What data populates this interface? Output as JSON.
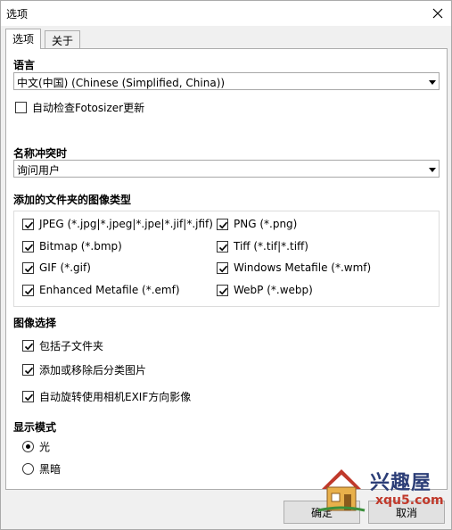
{
  "window": {
    "title": "选项"
  },
  "tabs": [
    {
      "label": "选项",
      "active": true
    },
    {
      "label": "关于",
      "active": false
    }
  ],
  "language": {
    "label": "语言",
    "selected": "中文(中国) (Chinese (Simplified, China))",
    "auto_check_label": "自动检查Fotosizer更新",
    "auto_check": false
  },
  "name_conflict": {
    "label": "名称冲突时",
    "selected": "询问用户"
  },
  "image_types": {
    "label": "添加的文件夹的图像类型",
    "items": [
      {
        "label": "JPEG (*.jpg|*.jpeg|*.jpe|*.jif|*.jfif)",
        "checked": true
      },
      {
        "label": "PNG (*.png)",
        "checked": true
      },
      {
        "label": "Bitmap (*.bmp)",
        "checked": true
      },
      {
        "label": "Tiff (*.tif|*.tiff)",
        "checked": true
      },
      {
        "label": "GIF (*.gif)",
        "checked": true
      },
      {
        "label": "Windows Metafile (*.wmf)",
        "checked": true
      },
      {
        "label": "Enhanced Metafile (*.emf)",
        "checked": true
      },
      {
        "label": "WebP (*.webp)",
        "checked": true
      }
    ]
  },
  "image_selection": {
    "label": "图像选择",
    "items": [
      {
        "label": "包括子文件夹",
        "checked": true
      },
      {
        "label": "添加或移除后分类图片",
        "checked": true
      },
      {
        "label": "自动旋转使用相机EXIF方向影像",
        "checked": true
      }
    ]
  },
  "display_mode": {
    "label": "显示模式",
    "options": [
      {
        "label": "光",
        "selected": true
      },
      {
        "label": "黑暗",
        "selected": false
      }
    ]
  },
  "buttons": {
    "ok": "确定",
    "cancel": "取消"
  },
  "watermark": {
    "brand": "兴趣屋",
    "site": "xqu5.com"
  },
  "colors": {
    "panel_bg": "#ffffff",
    "window_bg": "#f0f0f0",
    "border": "#adadad"
  }
}
